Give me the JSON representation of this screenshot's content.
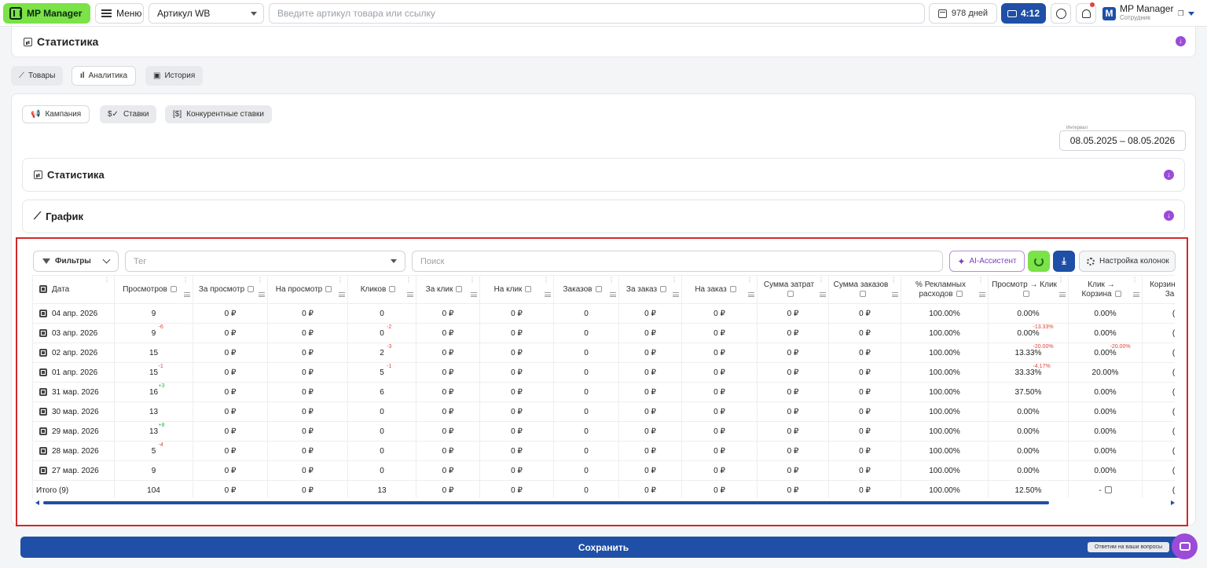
{
  "topbar": {
    "logo": "MP Manager",
    "menu_label": "Меню",
    "artikul_select": "Артикул WB",
    "search_placeholder": "Введите артикул товара или ссылку",
    "days": "978 дней",
    "timer": "4:12",
    "user_name": "MP Manager",
    "user_role": "Сотрудник",
    "avatar_letter": "M"
  },
  "top_section": {
    "title": "Статистика"
  },
  "tabs": [
    "Товары",
    "Аналитика",
    "История"
  ],
  "subtabs": [
    "Кампания",
    "Ставки",
    "Конкурентные ставки"
  ],
  "interval": {
    "label": "Интервал",
    "value": "08.05.2025 – 08.05.2026"
  },
  "sections": {
    "stats": "Статистика",
    "chart": "График"
  },
  "toolbar": {
    "filters": "Фильтры",
    "tag_placeholder": "Тег",
    "search_placeholder": "Поиск",
    "ai": "AI-Ассистент",
    "columns": "Настройка колонок"
  },
  "table": {
    "headers": [
      "Дата",
      "Просмотров",
      "За просмотр",
      "На просмотр",
      "Кликов",
      "За клик",
      "На клик",
      "Заказов",
      "За заказ",
      "На заказ",
      "Сумма затрат",
      "Сумма заказов",
      "% Рекламных расходов",
      "Просмотр → Клик",
      "Клик → Корзина",
      "Корзина → За"
    ],
    "rows": [
      {
        "date": "04 апр. 2026",
        "views": "9",
        "views_d": "",
        "cost_view": "0 ₽",
        "per_view": "0 ₽",
        "clicks": "0",
        "clicks_d": "",
        "cost_click": "0 ₽",
        "per_click": "0 ₽",
        "orders": "0",
        "cost_order": "0 ₽",
        "per_order": "0 ₽",
        "spend": "0 ₽",
        "orders_sum": "0 ₽",
        "drr": "100.00%",
        "ctr": "0.00%",
        "ctr_d": "",
        "cart": "0.00%",
        "cart_d": "",
        "last": "("
      },
      {
        "date": "03 апр. 2026",
        "views": "9",
        "views_d": "-6",
        "cost_view": "0 ₽",
        "per_view": "0 ₽",
        "clicks": "0",
        "clicks_d": "-2",
        "cost_click": "0 ₽",
        "per_click": "0 ₽",
        "orders": "0",
        "cost_order": "0 ₽",
        "per_order": "0 ₽",
        "spend": "0 ₽",
        "orders_sum": "0 ₽",
        "drr": "100.00%",
        "ctr": "0.00%",
        "ctr_d": "-13.33%",
        "cart": "0.00%",
        "cart_d": "",
        "last": "("
      },
      {
        "date": "02 апр. 2026",
        "views": "15",
        "views_d": "",
        "cost_view": "0 ₽",
        "per_view": "0 ₽",
        "clicks": "2",
        "clicks_d": "-3",
        "cost_click": "0 ₽",
        "per_click": "0 ₽",
        "orders": "0",
        "cost_order": "0 ₽",
        "per_order": "0 ₽",
        "spend": "0 ₽",
        "orders_sum": "0 ₽",
        "drr": "100.00%",
        "ctr": "13.33%",
        "ctr_d": "-20.00%",
        "cart": "0.00%",
        "cart_d": "-20.00%",
        "last": "("
      },
      {
        "date": "01 апр. 2026",
        "views": "15",
        "views_d": "-1",
        "cost_view": "0 ₽",
        "per_view": "0 ₽",
        "clicks": "5",
        "clicks_d": "-1",
        "cost_click": "0 ₽",
        "per_click": "0 ₽",
        "orders": "0",
        "cost_order": "0 ₽",
        "per_order": "0 ₽",
        "spend": "0 ₽",
        "orders_sum": "0 ₽",
        "drr": "100.00%",
        "ctr": "33.33%",
        "ctr_d": "-4.17%",
        "cart": "20.00%",
        "cart_d": "",
        "last": "("
      },
      {
        "date": "31 мар. 2026",
        "views": "16",
        "views_d": "+3",
        "cost_view": "0 ₽",
        "per_view": "0 ₽",
        "clicks": "6",
        "clicks_d": "",
        "cost_click": "0 ₽",
        "per_click": "0 ₽",
        "orders": "0",
        "cost_order": "0 ₽",
        "per_order": "0 ₽",
        "spend": "0 ₽",
        "orders_sum": "0 ₽",
        "drr": "100.00%",
        "ctr": "37.50%",
        "ctr_d": "",
        "cart": "0.00%",
        "cart_d": "",
        "last": "("
      },
      {
        "date": "30 мар. 2026",
        "views": "13",
        "views_d": "",
        "cost_view": "0 ₽",
        "per_view": "0 ₽",
        "clicks": "0",
        "clicks_d": "",
        "cost_click": "0 ₽",
        "per_click": "0 ₽",
        "orders": "0",
        "cost_order": "0 ₽",
        "per_order": "0 ₽",
        "spend": "0 ₽",
        "orders_sum": "0 ₽",
        "drr": "100.00%",
        "ctr": "0.00%",
        "ctr_d": "",
        "cart": "0.00%",
        "cart_d": "",
        "last": "("
      },
      {
        "date": "29 мар. 2026",
        "views": "13",
        "views_d": "+8",
        "cost_view": "0 ₽",
        "per_view": "0 ₽",
        "clicks": "0",
        "clicks_d": "",
        "cost_click": "0 ₽",
        "per_click": "0 ₽",
        "orders": "0",
        "cost_order": "0 ₽",
        "per_order": "0 ₽",
        "spend": "0 ₽",
        "orders_sum": "0 ₽",
        "drr": "100.00%",
        "ctr": "0.00%",
        "ctr_d": "",
        "cart": "0.00%",
        "cart_d": "",
        "last": "("
      },
      {
        "date": "28 мар. 2026",
        "views": "5",
        "views_d": "-4",
        "cost_view": "0 ₽",
        "per_view": "0 ₽",
        "clicks": "0",
        "clicks_d": "",
        "cost_click": "0 ₽",
        "per_click": "0 ₽",
        "orders": "0",
        "cost_order": "0 ₽",
        "per_order": "0 ₽",
        "spend": "0 ₽",
        "orders_sum": "0 ₽",
        "drr": "100.00%",
        "ctr": "0.00%",
        "ctr_d": "",
        "cart": "0.00%",
        "cart_d": "",
        "last": "("
      },
      {
        "date": "27 мар. 2026",
        "views": "9",
        "views_d": "",
        "cost_view": "0 ₽",
        "per_view": "0 ₽",
        "clicks": "0",
        "clicks_d": "",
        "cost_click": "0 ₽",
        "per_click": "0 ₽",
        "orders": "0",
        "cost_order": "0 ₽",
        "per_order": "0 ₽",
        "spend": "0 ₽",
        "orders_sum": "0 ₽",
        "drr": "100.00%",
        "ctr": "0.00%",
        "ctr_d": "",
        "cart": "0.00%",
        "cart_d": "",
        "last": "("
      }
    ],
    "total": {
      "label": "Итого (9)",
      "views": "104",
      "cost_view": "0 ₽",
      "per_view": "0 ₽",
      "clicks": "13",
      "cost_click": "0 ₽",
      "per_click": "0 ₽",
      "orders": "0",
      "cost_order": "0 ₽",
      "per_order": "0 ₽",
      "spend": "0 ₽",
      "orders_sum": "0 ₽",
      "drr": "100.00%",
      "ctr": "12.50%",
      "cart": "-",
      "last": "("
    }
  },
  "save_label": "Сохранить",
  "faq_label": "Ответим на ваши вопросы",
  "colors": {
    "accent_green": "#7be247",
    "primary_blue": "#1f4fa6",
    "purple": "#9b4bd8",
    "frame_red": "#d22828"
  }
}
